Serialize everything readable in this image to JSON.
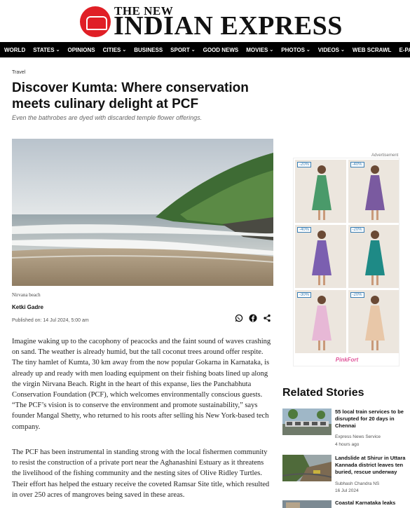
{
  "masthead": {
    "brand_line1": "THE NEW",
    "brand_line2": "INDIAN EXPRESS"
  },
  "nav": [
    {
      "label": "WORLD",
      "has_dropdown": false
    },
    {
      "label": "STATES",
      "has_dropdown": true
    },
    {
      "label": "OPINIONS",
      "has_dropdown": false
    },
    {
      "label": "CITIES",
      "has_dropdown": true
    },
    {
      "label": "BUSINESS",
      "has_dropdown": false
    },
    {
      "label": "SPORT",
      "has_dropdown": true
    },
    {
      "label": "GOOD NEWS",
      "has_dropdown": false
    },
    {
      "label": "MOVIES",
      "has_dropdown": true
    },
    {
      "label": "PHOTOS",
      "has_dropdown": true
    },
    {
      "label": "VIDEOS",
      "has_dropdown": true
    },
    {
      "label": "WEB SCRAWL",
      "has_dropdown": false
    },
    {
      "label": "E-PAPER",
      "has_dropdown": false
    }
  ],
  "article": {
    "section": "Travel",
    "headline": "Discover Kumta: Where conservation meets culinary delight at PCF",
    "subheadline": "Even the bathrobes are dyed with discarded temple flower offerings.",
    "image_caption": "Nirvana beach",
    "author": "Ketki Gadre",
    "published": "Published on: 14 Jul 2024, 5:00 am",
    "paragraphs": [
      "Imagine waking up to the cacophony of peacocks and the faint sound of waves crashing on sand. The weather is already humid, but the tall coconut trees around offer respite. The tiny hamlet of Kumta, 30 km away from the now popular Gokarna in Karnataka, is already up and ready with men loading equipment on their fishing boats lined up along the virgin Nirvana Beach. Right in the heart of this expanse, lies the Panchabhuta Conservation Foundation (PCF), which welcomes environmentally conscious guests. “The PCF’s vision is to conserve the environment and promote sustainability,” says founder Mangal Shetty, who returned to his roots after selling his New York-based tech company.",
      "The PCF has been instrumental in standing strong with the local fishermen community to resist the construction of a private port near the Aghanashini Estuary as it threatens the livelihood of the fishing community and the nesting sites of Olive Ridley Turtles. Their effort has helped the estuary receive the coveted Ramsar Site title, which resulted in over 250 acres of mangroves being saved in these areas."
    ]
  },
  "share": {
    "icons": [
      "whatsapp-icon",
      "facebook-icon",
      "share-icon"
    ]
  },
  "ad": {
    "label": "Advertisement",
    "brand": "PinkFort",
    "badges": [
      "-20%",
      "-40%",
      "-40%",
      "-20%",
      "-30%",
      "-20%"
    ],
    "dress_colors": [
      "#4a9a6a",
      "#7a5aa0",
      "#7b5fb0",
      "#1e8a86",
      "#e7b8d6",
      "#e8c7a8"
    ]
  },
  "related": {
    "title": "Related Stories",
    "items": [
      {
        "headline": "55 local train services to be disrupted for 20 days in Chennai",
        "author": "Express News Service",
        "date": "4 hours ago"
      },
      {
        "headline": "Landslide at Shirur in Uttara Kannada district leaves ten buried, rescue underway",
        "author": "Subhash Chandra NS",
        "date": "16 Jul 2024"
      },
      {
        "headline": "Coastal Karnataka leaks",
        "author": "",
        "date": ""
      }
    ]
  },
  "colors": {
    "brand_red": "#e01f26",
    "nav_bg": "#000000",
    "accent_pink": "#e0559a"
  }
}
